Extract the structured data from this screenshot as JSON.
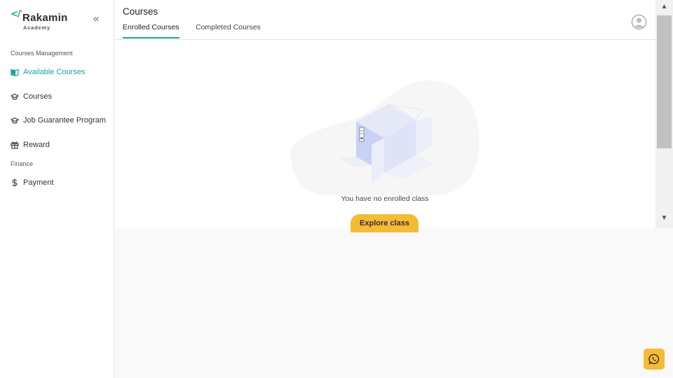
{
  "brand": {
    "mark": "</",
    "name": "Rakamin",
    "sub": "Academy"
  },
  "sidebar": {
    "collapse_glyph": "«",
    "sections": [
      {
        "label": "Courses Management"
      },
      {
        "label": "Finance"
      }
    ],
    "items": [
      {
        "label": "Available Courses",
        "icon": "book-open-icon",
        "active": true
      },
      {
        "label": "Courses",
        "icon": "graduation-cap-icon"
      },
      {
        "label": "Job Guarantee Program",
        "icon": "graduation-cap-icon"
      },
      {
        "label": "Reward",
        "icon": "gift-icon"
      },
      {
        "label": "Payment",
        "icon": "dollar-icon"
      }
    ]
  },
  "header": {
    "title": "Courses",
    "tabs": [
      {
        "label": "Enrolled Courses",
        "active": true
      },
      {
        "label": "Completed Courses"
      }
    ]
  },
  "empty_state": {
    "message": "You have no enrolled class",
    "button_label": "Explore class",
    "illustration": "empty-box-illustration"
  },
  "scrollbar": {
    "up_glyph": "▲",
    "down_glyph": "▼"
  },
  "colors": {
    "accent": "#1aa39a",
    "button": "#f5bb36",
    "background": "#f9f9f9"
  }
}
